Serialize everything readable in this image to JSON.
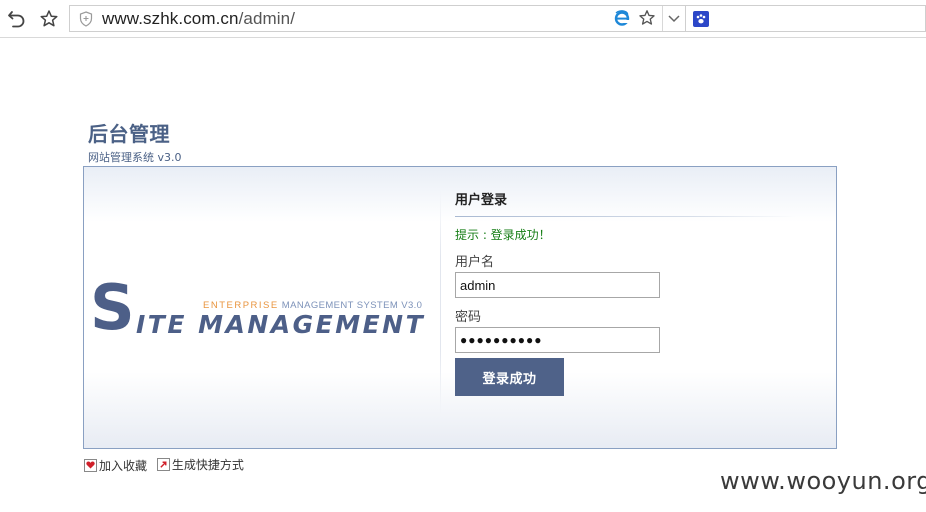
{
  "browser": {
    "url_host": "www.szhk.com.cn",
    "url_path": "/admin/",
    "icons": {
      "back": "back-arrow-icon",
      "favorite": "star-outline-icon",
      "security": "shield-icon",
      "ie": "ie-compat-icon",
      "bookmark": "star-icon",
      "dropdown": "chevron-down-icon",
      "search_engine": "baidu-paw-icon"
    }
  },
  "page": {
    "title": "后台管理",
    "subtitle": "网站管理系统 v3.0"
  },
  "logo": {
    "big_letter": "S",
    "enterprise": "ENTERPRISE",
    "system": "MANAGEMENT SYSTEM V3.0",
    "rest": "ITE MANAGEMENT"
  },
  "login": {
    "heading": "用户登录",
    "tip": "提示 : 登录成功！",
    "username_label": "用户名",
    "username_value": "admin",
    "password_label": "密码",
    "password_value": "●●●●●●●●●●",
    "submit_label": "登录成功"
  },
  "links": {
    "bookmark": "加入收藏",
    "shortcut": "生成快捷方式"
  },
  "watermark": "www.wooyun.org",
  "colors": {
    "brand": "#4d5f88",
    "accent": "#e9953f",
    "success": "#167e16",
    "button": "#4f6289",
    "panel_border": "#8aa0c2"
  }
}
